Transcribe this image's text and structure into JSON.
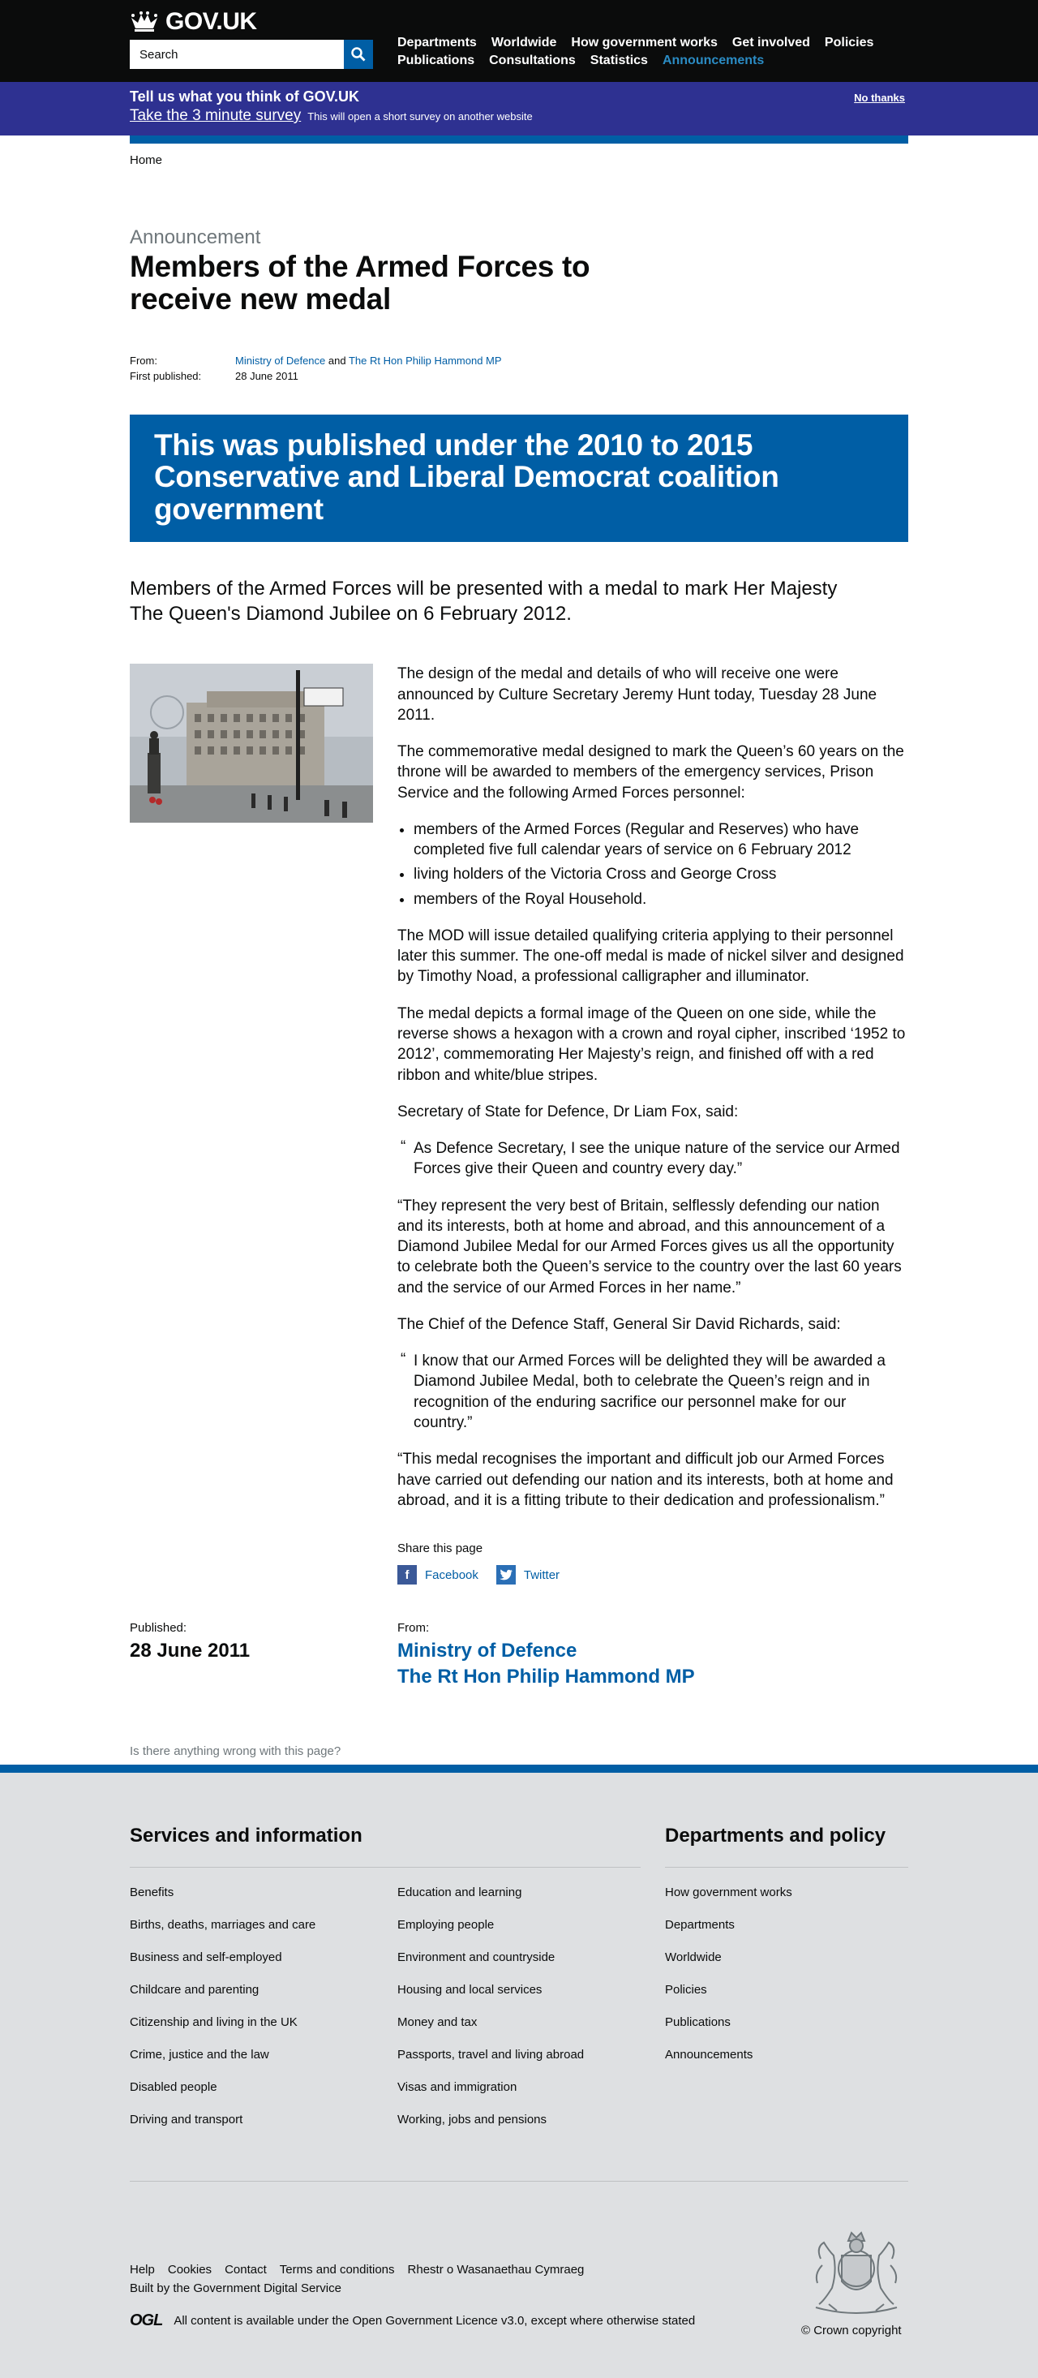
{
  "header": {
    "logo_text": "GOV.UK",
    "search_placeholder": "Search",
    "nav": [
      {
        "label": "Departments"
      },
      {
        "label": "Worldwide"
      },
      {
        "label": "How government works"
      },
      {
        "label": "Get involved"
      },
      {
        "label": "Policies"
      },
      {
        "label": "Publications"
      },
      {
        "label": "Consultations"
      },
      {
        "label": "Statistics"
      },
      {
        "label": "Announcements"
      }
    ]
  },
  "survey": {
    "title": "Tell us what you think of GOV.UK",
    "link": "Take the 3 minute survey",
    "note": "This will open a short survey on another website",
    "dismiss": "No thanks"
  },
  "breadcrumb": {
    "home": "Home"
  },
  "article": {
    "context": "Announcement",
    "title": "Members of the Armed Forces to receive new medal",
    "meta": {
      "from_label": "From:",
      "from_org1": "Ministry of Defence",
      "from_and": "and",
      "from_org2": "The Rt Hon Philip Hammond MP",
      "published_label": "First published:",
      "published_value": "28 June 2011"
    },
    "history_notice": "This was published under the 2010 to 2015 Conservative and Liberal Democrat coalition government",
    "summary": "Members of the Armed Forces will be presented with a medal to mark Her Majesty The Queen's Diamond Jubilee on 6 February 2012.",
    "body": {
      "p1": "The design of the medal and details of who will receive one were announced by Culture Secretary Jeremy Hunt today, Tuesday 28 June 2011.",
      "p2": "The commemorative medal designed to mark the Queen’s 60 years on the throne will be awarded to members of the emergency services, Prison Service and the following Armed Forces personnel:",
      "list": [
        "members of the Armed Forces (Regular and Reserves) who have completed five full calendar years of service on 6 February 2012",
        "living holders of the Victoria Cross and George Cross",
        "members of the Royal Household."
      ],
      "p3": "The MOD will issue detailed qualifying criteria applying to their personnel later this summer. The one-off medal is made of nickel silver and designed by Timothy Noad, a professional calligrapher and illuminator.",
      "p4": "The medal depicts a formal image of the Queen on one side, while the reverse shows a hexagon with a crown and royal cipher, inscribed ‘1952 to 2012’, commemorating Her Majesty’s reign, and finished off with a red ribbon and white/blue stripes.",
      "p5": "Secretary of State for Defence, Dr Liam Fox, said:",
      "quote_mark": "“",
      "quote1": "As Defence Secretary, I see the unique nature of the service our Armed Forces give their Queen and country every day.”",
      "p6": "“They represent the very best of Britain, selflessly defending our nation and its interests, both at home and abroad, and this announcement of a Diamond Jubilee Medal for our Armed Forces gives us all the opportunity to celebrate both the Queen’s service to the country over the last 60 years and the service of our Armed Forces in her name.”",
      "p7": "The Chief of the Defence Staff, General Sir David Richards, said:",
      "quote2": "I know that our Armed Forces will be delighted they will be awarded a Diamond Jubilee Medal, both to celebrate the Queen’s reign and in recognition of the enduring sacrifice our personnel make for our country.”",
      "p8": "“This medal recognises the important and difficult job our Armed Forces have carried out defending our nation and its interests, both at home and abroad, and it is a fitting tribute to their dedication and professionalism.”"
    },
    "share": {
      "title": "Share this page",
      "facebook": "Facebook",
      "twitter": "Twitter"
    },
    "published": {
      "label": "Published:",
      "date": "28 June 2011",
      "from_label": "From:",
      "org1": "Ministry of Defence",
      "org2": "The Rt Hon Philip Hammond MP"
    },
    "report_link": "Is there anything wrong with this page?"
  },
  "footer": {
    "services_title": "Services and information",
    "services_col1": [
      "Benefits",
      "Births, deaths, marriages and care",
      "Business and self-employed",
      "Childcare and parenting",
      "Citizenship and living in the UK",
      "Crime, justice and the law",
      "Disabled people",
      "Driving and transport"
    ],
    "services_col2": [
      "Education and learning",
      "Employing people",
      "Environment and countryside",
      "Housing and local services",
      "Money and tax",
      "Passports, travel and living abroad",
      "Visas and immigration",
      "Working, jobs and pensions"
    ],
    "depts_title": "Departments and policy",
    "depts": [
      "How government works",
      "Departments",
      "Worldwide",
      "Policies",
      "Publications",
      "Announcements"
    ],
    "bottom_links": [
      "Help",
      "Cookies",
      "Contact",
      "Terms and conditions",
      "Rhestr o Wasanaethau Cymraeg"
    ],
    "built_by_prefix": "Built by the",
    "built_by_link": "Government Digital Service",
    "ogl": "OGL",
    "licence_prefix": "All content is available under the",
    "licence_link": "Open Government Licence v3.0",
    "licence_suffix": ", except where otherwise stated",
    "copyright": "© Crown copyright"
  },
  "colors": {
    "header_bg": "#0b0c0c",
    "survey_bg": "#2e3191",
    "brand_blue": "#005ea5",
    "nav_active": "#2b8cc4",
    "footer_bg": "#dee0e2",
    "facebook": "#3b5998",
    "twitter": "#2b6fb6"
  }
}
